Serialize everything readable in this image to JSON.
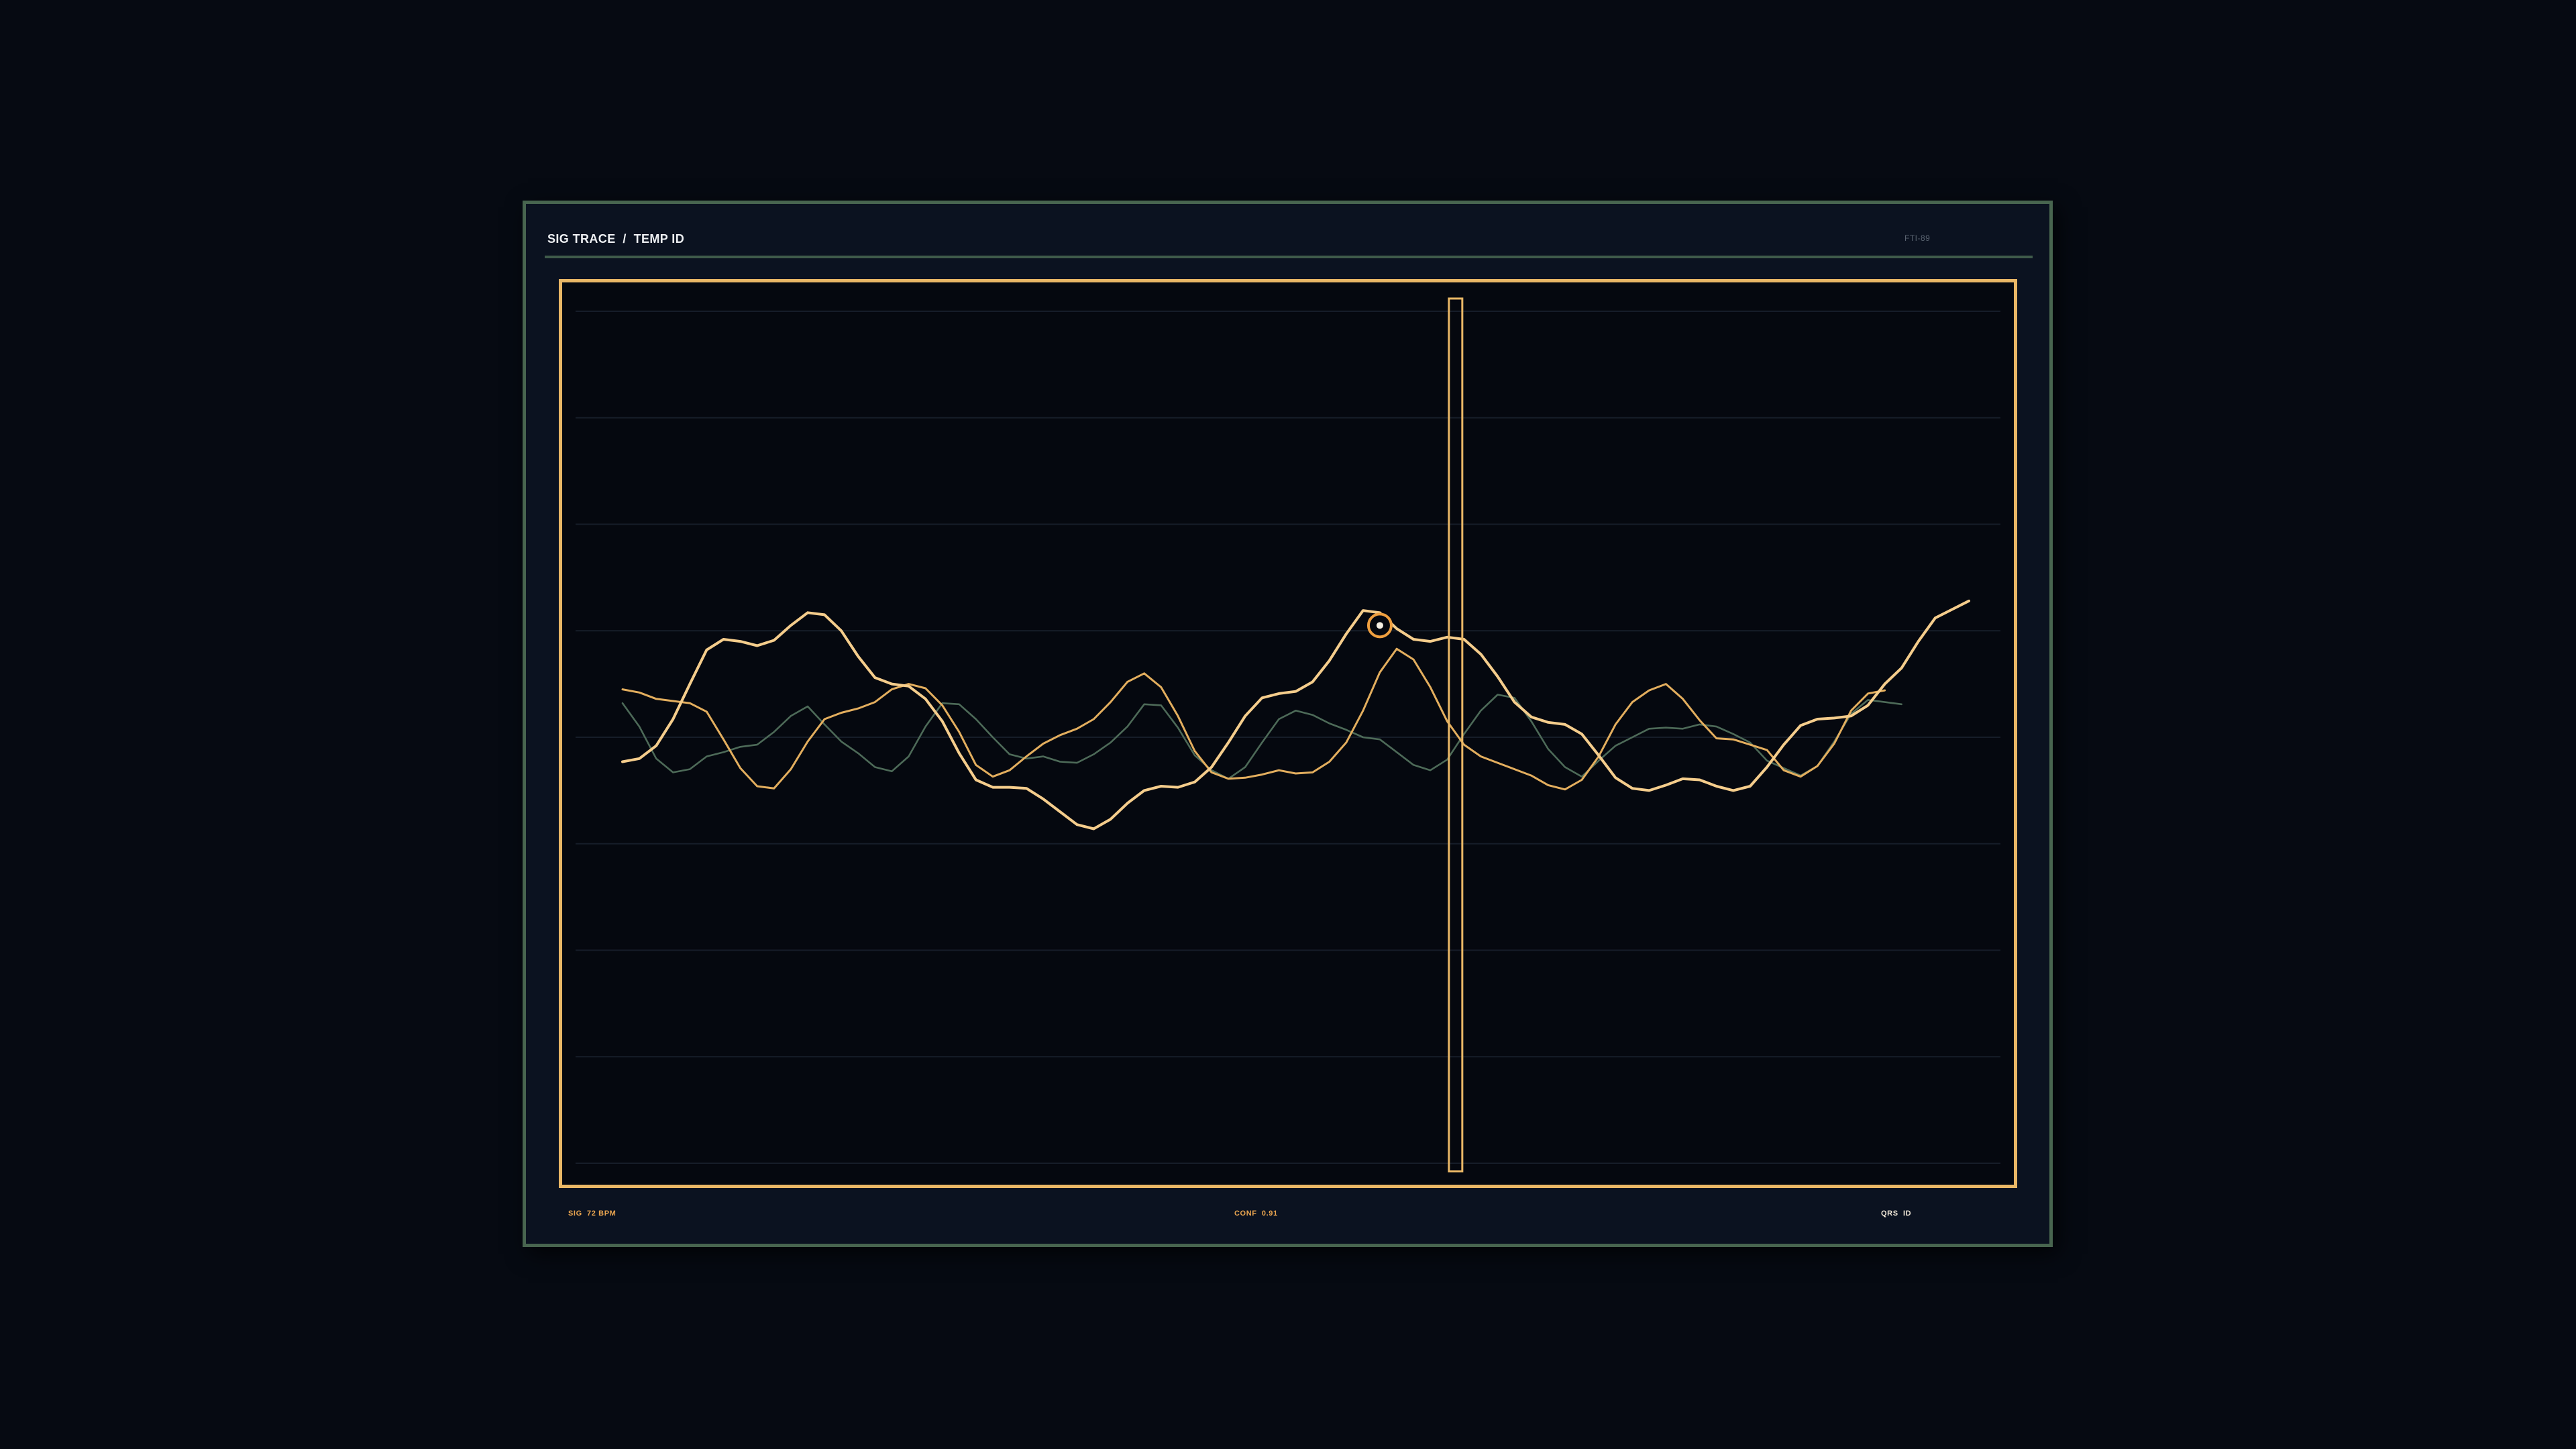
{
  "window": {
    "title": "SIG TRACE  /  TEMP ID",
    "frame_tag": "FTI-89"
  },
  "footer": {
    "sig_label": "SIG  72 BPM",
    "conf_label": "CONF  0.91",
    "qrs_label": "QRS  ID"
  },
  "colors": {
    "background": "#060a12",
    "panel": "#0b1220",
    "frame_border": "#48654f",
    "plot_border": "#e9b766",
    "trace_primary": "#f5cd8c",
    "trace_secondary": "#e3ae5e",
    "trace_tertiary": "#4d6a58",
    "marker": "#ef9f3f"
  },
  "chart_data": {
    "type": "line",
    "title": "",
    "xlabel": "",
    "ylabel": "",
    "xlim": [
      0,
      80
    ],
    "ylim": [
      -4,
      4
    ],
    "grid": true,
    "y_ticks": [
      4,
      3,
      2,
      1,
      0,
      -1,
      -2,
      -3,
      -4
    ],
    "y_tick_labels": [
      "",
      "",
      "",
      "",
      "",
      "",
      "",
      "",
      ""
    ],
    "x": [
      0,
      1,
      2,
      3,
      4,
      5,
      6,
      7,
      8,
      9,
      10,
      11,
      12,
      13,
      14,
      15,
      16,
      17,
      18,
      19,
      20,
      21,
      22,
      23,
      24,
      25,
      26,
      27,
      28,
      29,
      30,
      31,
      32,
      33,
      34,
      35,
      36,
      37,
      38,
      39,
      40,
      41,
      42,
      43,
      44,
      45,
      46,
      47,
      48,
      49,
      50,
      51,
      52,
      53,
      54,
      55,
      56,
      57,
      58,
      59,
      60,
      61,
      62,
      63,
      64,
      65,
      66,
      67,
      68,
      69,
      70,
      71,
      72,
      73,
      74,
      75,
      76,
      77,
      78,
      79,
      80
    ],
    "series": [
      {
        "values": [
          -0.23,
          -0.2,
          -0.08,
          0.17,
          0.5,
          0.82,
          0.92,
          0.9,
          0.86,
          0.91,
          1.05,
          1.17,
          1.15,
          1.0,
          0.76,
          0.56,
          0.5,
          0.48,
          0.36,
          0.15,
          -0.15,
          -0.4,
          -0.47,
          -0.47,
          -0.48,
          -0.58,
          -0.7,
          -0.82,
          -0.86,
          -0.77,
          -0.62,
          -0.5,
          -0.46,
          -0.47,
          -0.42,
          -0.28,
          -0.05,
          0.2,
          0.37,
          0.41,
          0.43,
          0.52,
          0.72,
          0.97,
          1.19,
          1.17,
          1.02,
          0.92,
          0.9,
          0.94,
          0.92,
          0.78,
          0.57,
          0.33,
          0.19,
          0.14,
          0.12,
          0.03,
          -0.17,
          -0.38,
          -0.48,
          -0.5,
          -0.45,
          -0.39,
          -0.4,
          -0.46,
          -0.5,
          -0.46,
          -0.28,
          -0.07,
          0.11,
          0.17,
          0.18,
          0.2,
          0.3,
          0.5,
          0.65,
          0.9,
          1.12,
          1.2,
          1.28
        ],
        "color": "#f5cd8c",
        "width": 4
      },
      {
        "values": [
          0.45,
          0.42,
          0.36,
          0.34,
          0.32,
          0.24,
          -0.02,
          -0.29,
          -0.46,
          -0.48,
          -0.3,
          -0.04,
          0.17,
          0.23,
          0.27,
          0.33,
          0.45,
          0.5,
          0.46,
          0.3,
          0.05,
          -0.26,
          -0.37,
          -0.31,
          -0.18,
          -0.06,
          0.02,
          0.08,
          0.17,
          0.33,
          0.52,
          0.6,
          0.47,
          0.2,
          -0.13,
          -0.33,
          -0.39,
          -0.38,
          -0.35,
          -0.31,
          -0.34,
          -0.33,
          -0.23,
          -0.05,
          0.25,
          0.61,
          0.83,
          0.73,
          0.47,
          0.15,
          -0.07,
          -0.18,
          -0.24,
          -0.3,
          -0.36,
          -0.45,
          -0.49,
          -0.4,
          -0.18,
          0.12,
          0.33,
          0.44,
          0.5,
          0.36,
          0.16,
          -0.01,
          -0.02,
          -0.07,
          -0.12,
          -0.31,
          -0.37,
          -0.27,
          -0.06,
          0.25,
          0.41,
          0.44
        ],
        "color": "#e3ae5e",
        "width": 3
      },
      {
        "values": [
          0.32,
          0.1,
          -0.2,
          -0.33,
          -0.3,
          -0.18,
          -0.14,
          -0.09,
          -0.07,
          0.05,
          0.2,
          0.29,
          0.12,
          -0.04,
          -0.15,
          -0.28,
          -0.32,
          -0.18,
          0.1,
          0.32,
          0.31,
          0.17,
          0.0,
          -0.16,
          -0.2,
          -0.18,
          -0.23,
          -0.24,
          -0.16,
          -0.05,
          0.1,
          0.31,
          0.3,
          0.09,
          -0.17,
          -0.31,
          -0.39,
          -0.28,
          -0.05,
          0.17,
          0.25,
          0.21,
          0.13,
          0.07,
          0.0,
          -0.02,
          -0.14,
          -0.26,
          -0.31,
          -0.21,
          0.03,
          0.25,
          0.4,
          0.37,
          0.15,
          -0.11,
          -0.28,
          -0.37,
          -0.22,
          -0.08,
          0.0,
          0.08,
          0.09,
          0.08,
          0.12,
          0.1,
          0.03,
          -0.05,
          -0.22,
          -0.29,
          -0.36,
          -0.27,
          -0.04,
          0.22,
          0.35,
          0.33,
          0.31
        ],
        "color": "#4d6a58",
        "width": 2.6
      }
    ],
    "cursor_x": 49.5,
    "marker": {
      "x": 45,
      "y": 1.05
    }
  }
}
